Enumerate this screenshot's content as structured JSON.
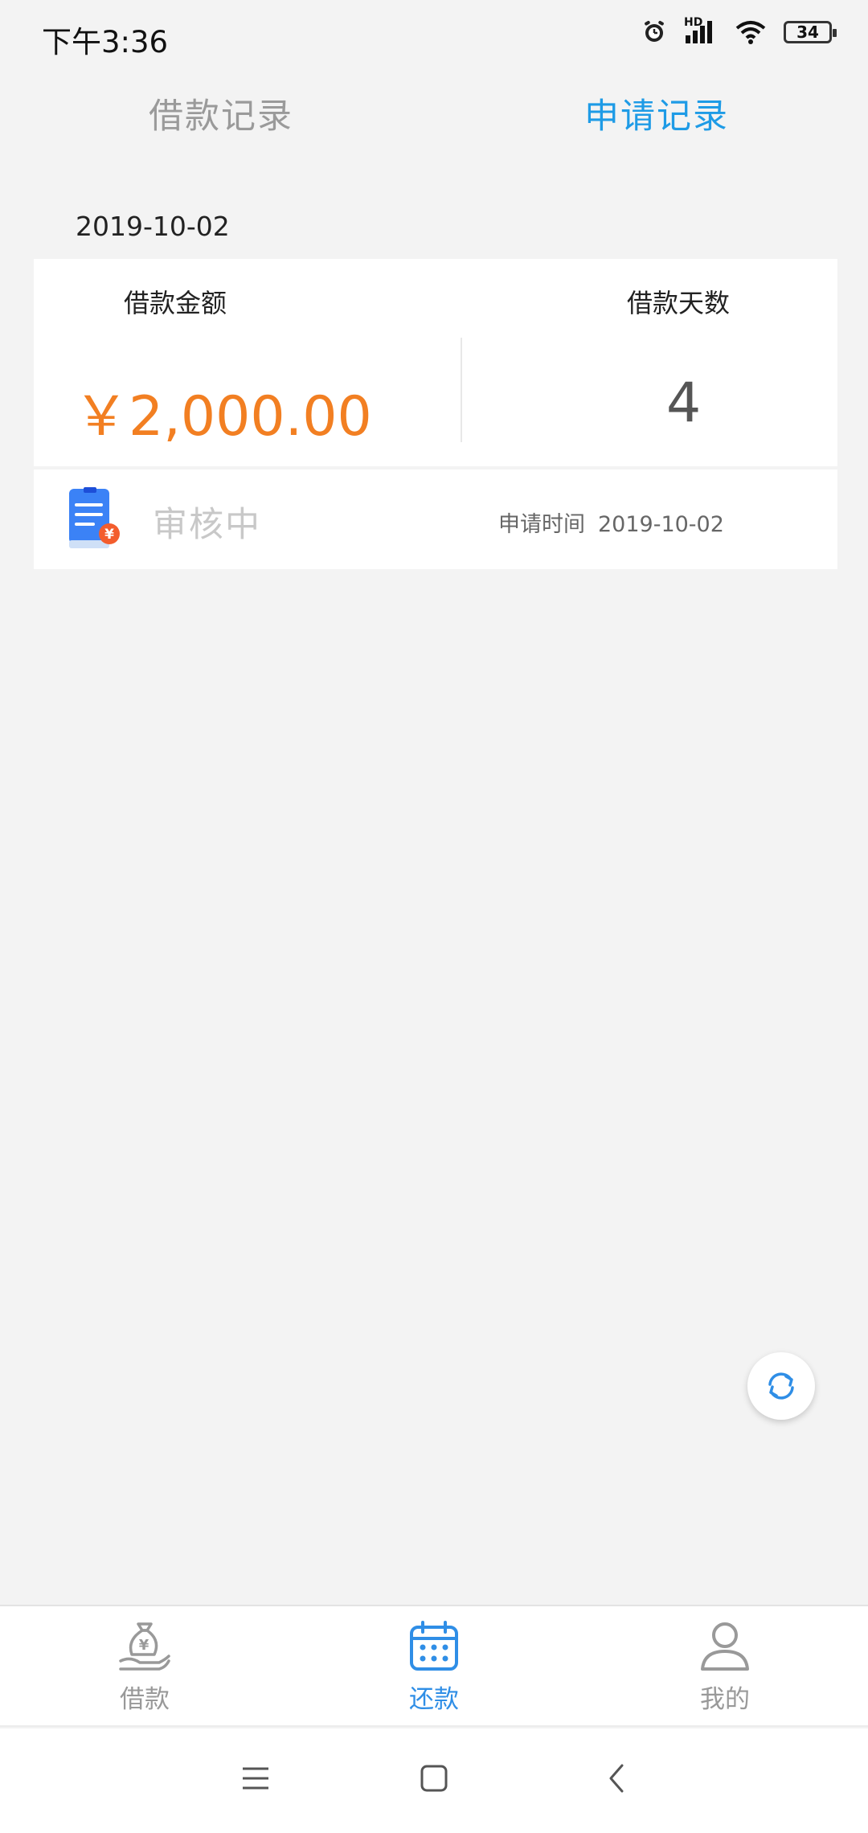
{
  "status_bar": {
    "time": "下午3:36",
    "battery_level": "34",
    "signal_label": "HD"
  },
  "tabs": [
    {
      "label": "借款记录",
      "active": false
    },
    {
      "label": "申请记录",
      "active": true
    }
  ],
  "record": {
    "date": "2019-10-02",
    "amount_label": "借款金额",
    "days_label": "借款天数",
    "amount_value": "￥2,000.00",
    "days_value": "4",
    "status": "审核中",
    "apply_time_label": "申请时间",
    "apply_time_value": "2019-10-02"
  },
  "bottom_nav": [
    {
      "label": "借款",
      "icon": "money-bag-hand-icon",
      "active": false
    },
    {
      "label": "还款",
      "icon": "calendar-icon",
      "active": true
    },
    {
      "label": "我的",
      "icon": "user-icon",
      "active": false
    }
  ],
  "colors": {
    "accent_blue": "#1e9be6",
    "amount_orange": "#f27f22",
    "inactive_gray": "#9a9a9a",
    "background": "#f3f3f3"
  }
}
